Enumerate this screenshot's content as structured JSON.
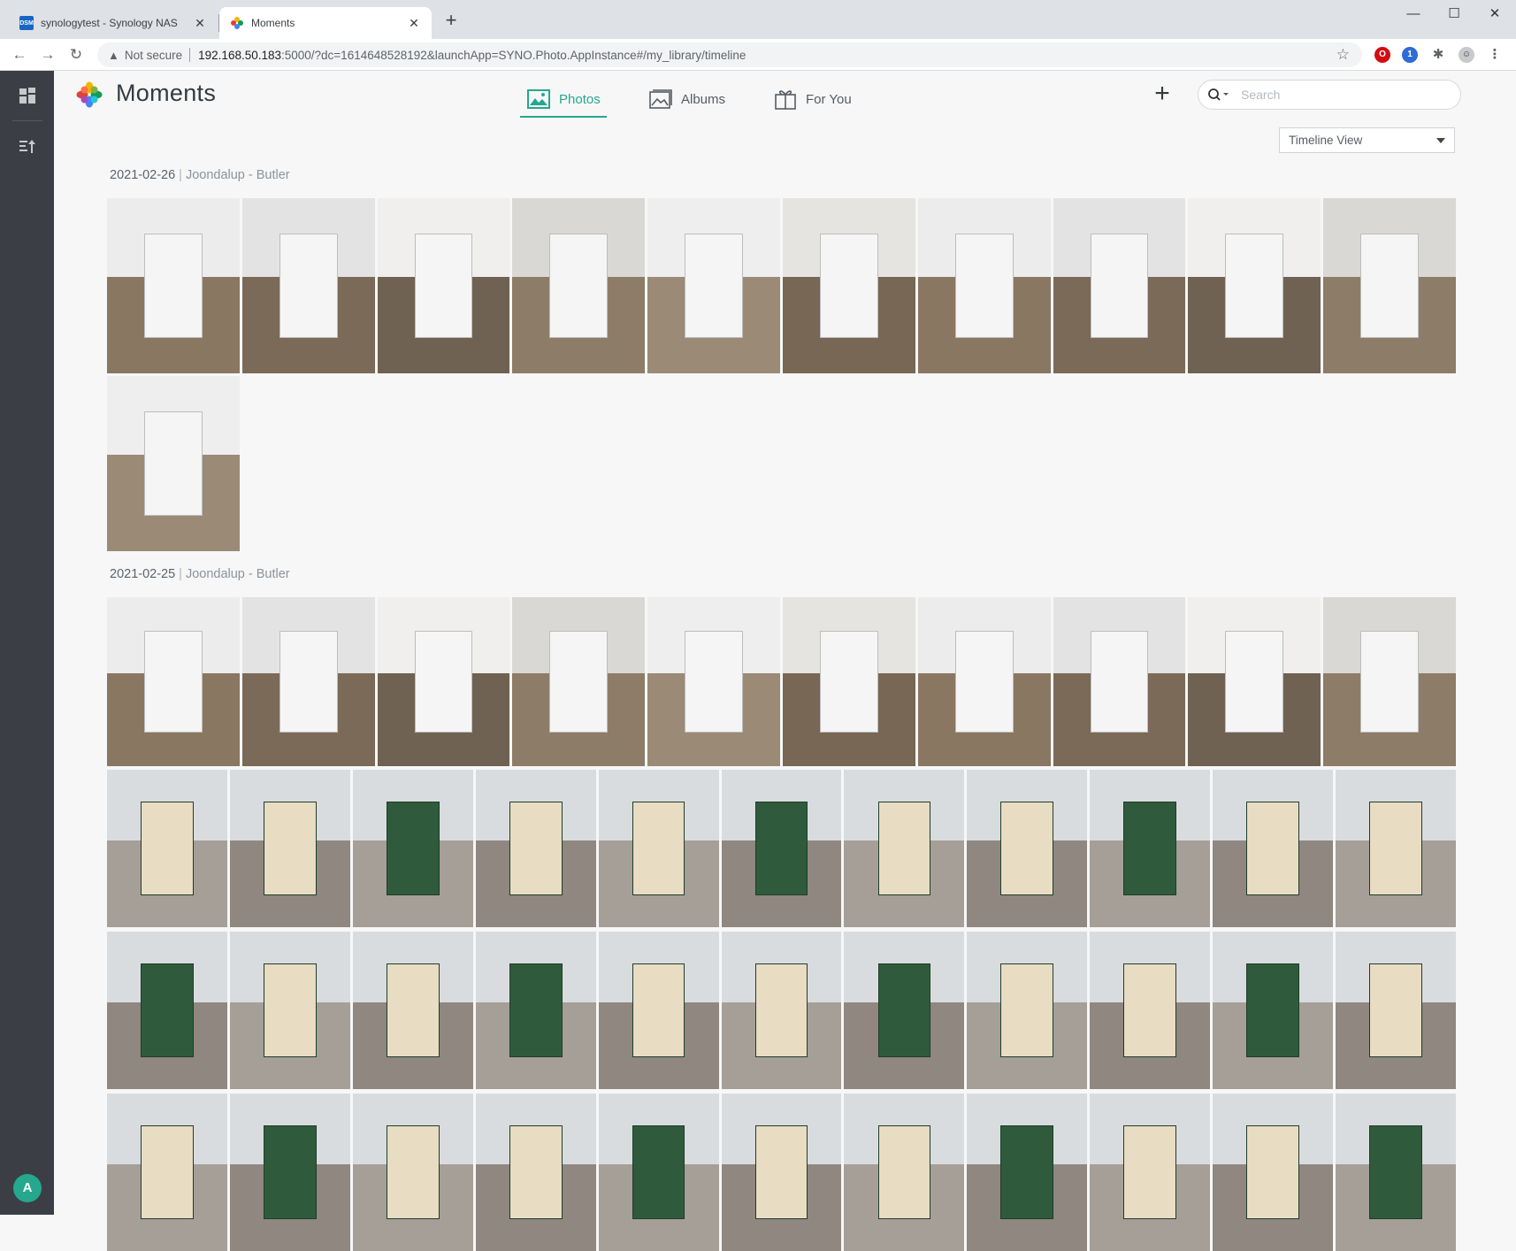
{
  "browser": {
    "tabs": [
      {
        "title": "synologytest - Synology NAS",
        "favicon": "DSM",
        "active": false
      },
      {
        "title": "Moments",
        "active": true
      }
    ],
    "security_label": "Not secure",
    "url_host": "192.168.50.183",
    "url_rest": ":5000/?dc=1614648528192&launchApp=SYNO.Photo.AppInstance#/my_library/timeline"
  },
  "sidebar": {
    "avatar_initial": "A"
  },
  "app": {
    "title": "Moments",
    "nav": [
      {
        "label": "Photos",
        "active": true
      },
      {
        "label": "Albums",
        "active": false
      },
      {
        "label": "For You",
        "active": false
      }
    ],
    "search_placeholder": "Search",
    "view_mode": "Timeline View",
    "accent_color": "#25a88e"
  },
  "timeline": [
    {
      "date": "2021-02-26",
      "location": "Joondalup - Butler",
      "photo_count": 11
    },
    {
      "date": "2021-02-25",
      "location": "Joondalup - Butler",
      "photo_count": 46
    }
  ]
}
